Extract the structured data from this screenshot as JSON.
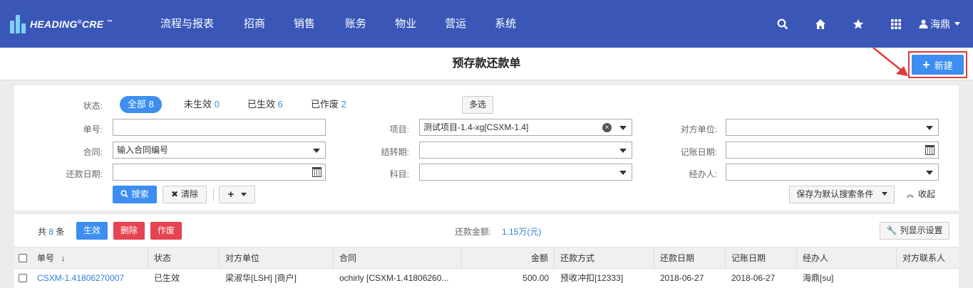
{
  "header": {
    "logo_text": "HEADING",
    "logo_reg": "®",
    "logo_text2": "CRE",
    "logo_tm": "™",
    "nav": [
      "流程与报表",
      "招商",
      "销售",
      "账务",
      "物业",
      "营运",
      "系统"
    ],
    "icons": [
      "search-icon",
      "home-icon",
      "star-icon",
      "apps-grid-icon"
    ],
    "user": "海鼎"
  },
  "title": {
    "page_title": "预存款还款单",
    "new_label": "新建"
  },
  "filters": {
    "status_label": "状态:",
    "status_pills": [
      {
        "label": "全部",
        "count": "8"
      },
      {
        "label": "未生效",
        "count": "0"
      },
      {
        "label": "已生效",
        "count": "6"
      },
      {
        "label": "已作废",
        "count": "2"
      }
    ],
    "multi_select": "多选",
    "bill_no_label": "单号:",
    "bill_no_value": "",
    "project_label": "项目:",
    "project_value": "测试项目-1.4-xg[CSXM-1.4]",
    "counterparty_label": "对方单位:",
    "counterparty_value": "",
    "contract_label": "合同:",
    "contract_value": "输入合同编号",
    "settle_period_label": "结转期:",
    "settle_period_value": "",
    "account_date_label": "记账日期:",
    "account_date_value": "",
    "repay_date_label": "还款日期:",
    "repay_date_value": "",
    "subject_label": "科目:",
    "subject_value": "",
    "handler_label": "经办人:",
    "handler_value": "",
    "search_btn": "搜索",
    "clear_btn": "清除",
    "add_btn": "+",
    "save_default_btn": "保存为默认搜索条件",
    "collapse_btn": "收起"
  },
  "list": {
    "total_prefix": "共",
    "total_count": "8",
    "total_suffix": "条",
    "btn_effect": "生效",
    "btn_delete": "删除",
    "btn_void": "作废",
    "amount_label": "还款金额:",
    "amount_value": "1.15万(元)",
    "column_settings": "列显示设置"
  },
  "table": {
    "columns": [
      "单号",
      "状态",
      "对方单位",
      "合同",
      "金额",
      "还款方式",
      "还款日期",
      "记账日期",
      "经办人",
      "对方联系人"
    ],
    "rows": [
      [
        "CSXM-1.41806270007",
        "已生效",
        "梁淑华[LSH] [商户]",
        "ochirly [CSXM-1.41806260...",
        "500.00",
        "预收冲扣[12333]",
        "2018-06-27",
        "2018-06-27",
        "海鼎[su]",
        ""
      ]
    ]
  },
  "colors": {
    "nav_bg": "#3a57b8",
    "primary": "#3d8ef0",
    "danger": "#e54450",
    "highlight_box": "#e53935"
  }
}
